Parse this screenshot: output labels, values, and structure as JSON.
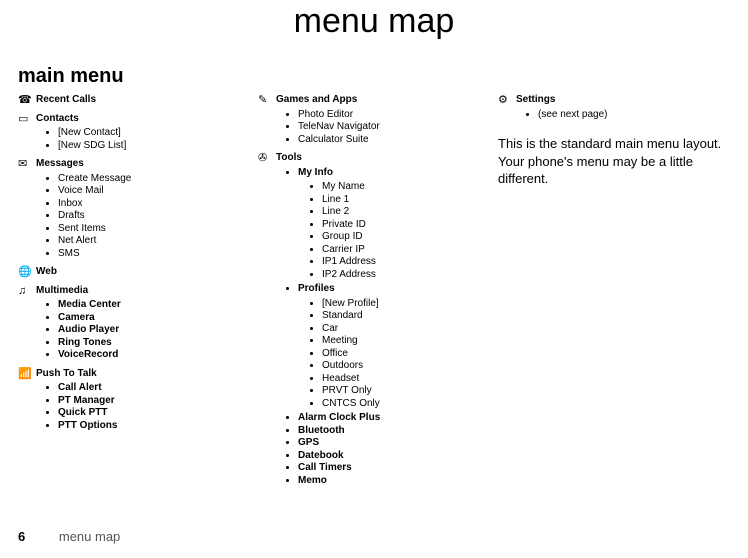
{
  "page_title": "menu map",
  "section_title": "main menu",
  "footer": {
    "page_number": "6",
    "text": "menu map"
  },
  "note": "This is the standard main menu layout. Your phone's menu may be a little different.",
  "icons": {
    "recent_calls": "☎",
    "contacts": "▭",
    "messages": "✉",
    "web": "🌐",
    "multimedia": "♫",
    "ptt": "📶",
    "games": "✎",
    "tools": "✇",
    "settings": "⚙"
  },
  "col1": {
    "recent_calls": "Recent Calls",
    "contacts": {
      "title": "Contacts",
      "items": [
        "[New Contact]",
        "[New SDG List]"
      ]
    },
    "messages": {
      "title": "Messages",
      "items": [
        "Create Message",
        "Voice Mail",
        "Inbox",
        "Drafts",
        "Sent Items",
        "Net Alert",
        "SMS"
      ]
    },
    "web": "Web",
    "multimedia": {
      "title": "Multimedia",
      "items": [
        "Media Center",
        "Camera",
        "Audio Player",
        "Ring Tones",
        "VoiceRecord"
      ]
    },
    "ptt": {
      "title": "Push To Talk",
      "items": [
        "Call Alert",
        "PT Manager",
        "Quick PTT",
        "PTT Options"
      ]
    }
  },
  "col2": {
    "games": {
      "title": "Games and Apps",
      "items": [
        "Photo Editor",
        "TeleNav Navigator",
        "Calculator Suite"
      ]
    },
    "tools": {
      "title": "Tools",
      "myinfo": {
        "title": "My Info",
        "items": [
          "My Name",
          "Line 1",
          "Line 2",
          "Private ID",
          "Group ID",
          "Carrier IP",
          "IP1 Address",
          "IP2 Address"
        ]
      },
      "profiles": {
        "title": "Profiles",
        "items": [
          "[New Profile]",
          "Standard",
          "Car",
          "Meeting",
          "Office",
          "Outdoors",
          "Headset",
          "PRVT Only",
          "CNTCS Only"
        ]
      },
      "rest": [
        "Alarm Clock Plus",
        "Bluetooth",
        "GPS",
        "Datebook",
        "Call Timers",
        "Memo"
      ]
    }
  },
  "col3": {
    "settings": {
      "title": "Settings",
      "items": [
        "(see next page)"
      ]
    }
  }
}
